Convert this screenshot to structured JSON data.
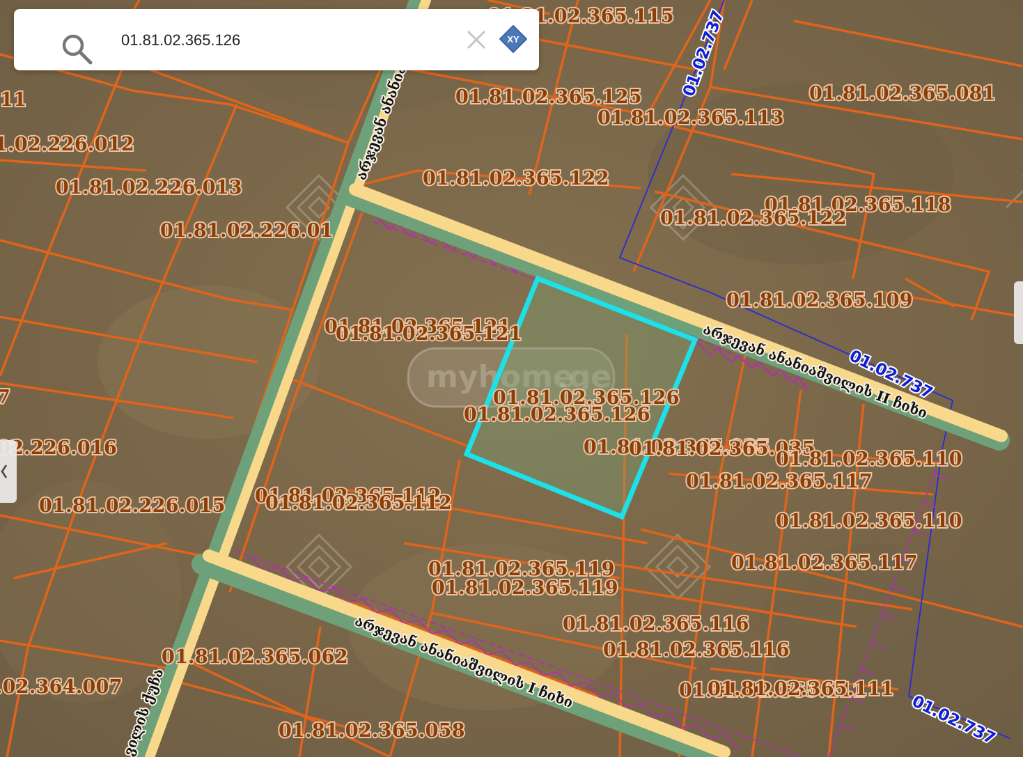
{
  "search": {
    "value": "01.81.02.365.126",
    "placeholder": "",
    "xy_label": "XY"
  },
  "watermark": {
    "brand": "myhome",
    "domain": ".ge"
  },
  "map": {
    "parcel_labels": [
      "01.81.02.365.115",
      "01.81.02.365.125",
      "01.81.02.365.113",
      "01.81.02.365.081",
      "11",
      "1.02.226.012",
      "01.81.02.226.013",
      "01.81.02.226.01",
      "01.81.02.365.122",
      "01.81.02.365.118",
      "01.81.02.365.122",
      "01.81.02.365.109",
      "01.81.02.365.121",
      "01.81.02.365.121",
      "01.81.02.365.126",
      "01.81.02.365.126",
      "01.81.02.365.035",
      "01.81.02.365.035",
      "01.81.02.365.110",
      "01.81.02.365.117",
      "01.81.02.365.110",
      "7",
      "02.226.016",
      "01.81.02.226.015",
      "01.81.02.365.112",
      "01.81.02.365.112",
      "01.81.02.365.119",
      "01.81.02.365.119",
      "01.81.02.365.117",
      "01.81.02.365.116",
      "01.81.02.365.116",
      "01.81.02.365.062",
      ".02.364.007",
      "01.81.02.365.111",
      "01.81.02.365.111",
      "01.81.02.365.058"
    ],
    "street_labels": [
      "არჯევან ანანიაშვილის II ჩიხი",
      "არჯევან ანანიაშვილის I ჩიხი",
      "არჯევან ანანიაშვილის",
      "ვილის ქუჩა"
    ],
    "boundary_labels": [
      "01.02.737",
      "01.02.737",
      "01.02.737"
    ],
    "colors": {
      "parcel_line": "#e0641a",
      "highlight": "#1ee0e8",
      "road_fill": "#f8d88a",
      "road_edge": "#6ea07a",
      "boundary": "#2a2ad8",
      "restriction": "#b030b0"
    }
  }
}
